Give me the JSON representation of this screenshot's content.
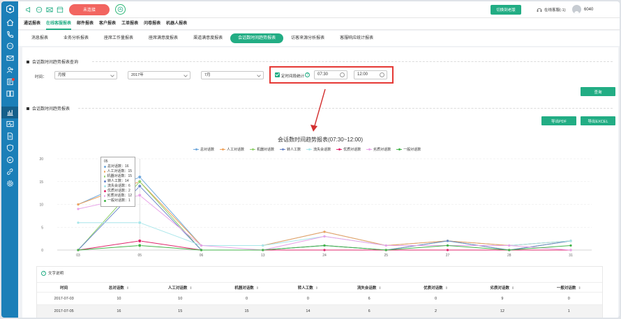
{
  "topbar": {
    "status_button": "未连接",
    "switch_button": "切换到老版",
    "online_status": "在线客服(-1)",
    "user_id": "6040"
  },
  "menu": [
    {
      "label": "通话报表",
      "active": false
    },
    {
      "label": "在线客服报表",
      "active": true
    },
    {
      "label": "邮件报表",
      "active": false
    },
    {
      "label": "客户报表",
      "active": false
    },
    {
      "label": "工单报表",
      "active": false
    },
    {
      "label": "问卷报表",
      "active": false
    },
    {
      "label": "机器人报表",
      "active": false
    }
  ],
  "subtabs": [
    {
      "label": "消息报表",
      "active": false
    },
    {
      "label": "业务分析报表",
      "active": false
    },
    {
      "label": "座席工作量报表",
      "active": false
    },
    {
      "label": "座席满意度报表",
      "active": false
    },
    {
      "label": "渠道满意度报表",
      "active": false
    },
    {
      "label": "会话数时间趋势报表",
      "active": true
    },
    {
      "label": "访客来源分析报表",
      "active": false
    },
    {
      "label": "客服响应统计报表",
      "active": false
    }
  ],
  "query": {
    "section_title": "会话数时间趋势报表查询",
    "time_label": "时间：",
    "period": "月报",
    "year": "2017年",
    "month": "7月",
    "timeframe_label": "定时间段统计",
    "start_time": "07:30",
    "end_time": "12:00",
    "query_button": "查询"
  },
  "trend": {
    "section_title": "会话数时间趋势报表",
    "export_pdf": "导出PDF",
    "export_excel": "导出EXCEL"
  },
  "chart_data": {
    "type": "line",
    "title": "会话数时间趋势报表(07:30~12:00)",
    "categories": [
      "03",
      "05",
      "06",
      "13",
      "24",
      "25",
      "27",
      "28",
      "31"
    ],
    "ylim": [
      0,
      20
    ],
    "yticks": [
      0,
      5,
      10,
      15,
      20
    ],
    "grid": true,
    "legend_position": "top",
    "series": [
      {
        "name": "总对话数",
        "color": "#6fa8dc",
        "values": [
          10,
          16,
          1,
          1,
          4,
          1,
          2,
          1,
          2
        ]
      },
      {
        "name": "人工对话数",
        "color": "#f0a35c",
        "values": [
          10,
          15,
          1,
          1,
          4,
          1,
          2,
          1,
          2
        ]
      },
      {
        "name": "机器对话数",
        "color": "#8fd16a",
        "values": [
          0,
          15,
          0,
          0,
          1,
          0,
          2,
          0,
          2
        ]
      },
      {
        "name": "转人工数",
        "color": "#6a86c9",
        "values": [
          0,
          14,
          0,
          0,
          1,
          0,
          2,
          0,
          2
        ]
      },
      {
        "name": "流失会话数",
        "color": "#a8e6ea",
        "values": [
          6,
          6,
          1,
          1,
          3,
          1,
          1,
          1,
          2
        ]
      },
      {
        "name": "优质对话数",
        "color": "#e0246b",
        "values": [
          0,
          2,
          0,
          0,
          0,
          0,
          0,
          0,
          0
        ]
      },
      {
        "name": "劣质对话数",
        "color": "#e8a2e8",
        "values": [
          9,
          12,
          1,
          0,
          3,
          1,
          1,
          1,
          0
        ]
      },
      {
        "name": "一般对话数",
        "color": "#43b54a",
        "values": [
          0,
          1,
          0,
          0,
          1,
          0,
          1,
          0,
          1
        ]
      }
    ],
    "tooltip": {
      "category": "05",
      "rows": [
        "总对话数：16",
        "人工对话数：15",
        "机器对话数：15",
        "转人工数：14",
        "流失会话数：6",
        "优质对话数：2",
        "劣质对话数：12",
        "一般对话数：1"
      ]
    }
  },
  "detail": {
    "title": "文字说明",
    "columns": [
      "时间",
      "总对话数",
      "人工对话数",
      "机器对话数",
      "转人工数",
      "流失会话数",
      "优质对话数",
      "劣质对话数",
      "一般对话数"
    ],
    "rows": [
      [
        "2017-07-03",
        "10",
        "10",
        "0",
        "0",
        "6",
        "0",
        "9",
        "0"
      ],
      [
        "2017-07-05",
        "16",
        "15",
        "15",
        "14",
        "6",
        "2",
        "12",
        "1"
      ]
    ]
  }
}
